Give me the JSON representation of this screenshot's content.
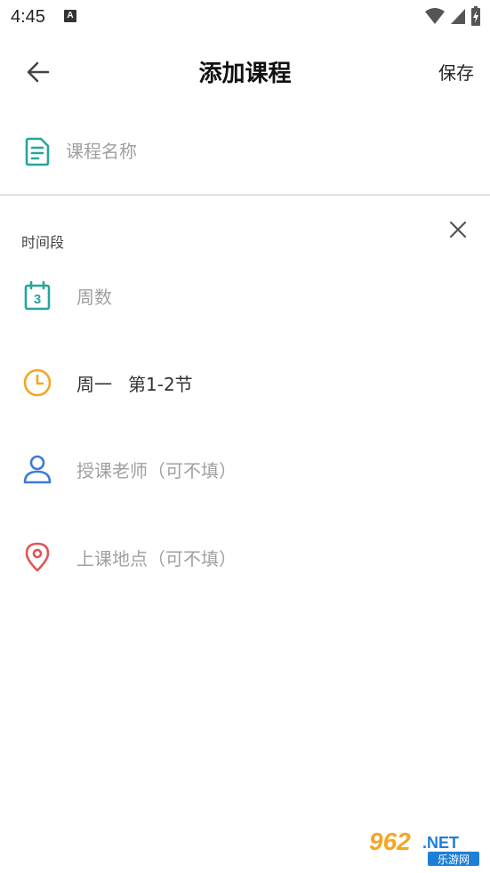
{
  "status_bar": {
    "time": "4:45",
    "notification_glyph": "A"
  },
  "toolbar": {
    "title": "添加课程",
    "save_label": "保存"
  },
  "course_name": {
    "placeholder": "课程名称",
    "value": ""
  },
  "time_section": {
    "label": "时间段",
    "weeks": {
      "placeholder": "周数",
      "calendar_number": "3"
    },
    "schedule": {
      "day": "周一",
      "period": "第1-2节"
    },
    "teacher": {
      "placeholder": "授课老师（可不填）"
    },
    "location": {
      "placeholder": "上课地点（可不填）"
    }
  },
  "colors": {
    "teal": "#26a69a",
    "orange": "#f5a623",
    "blue": "#3d7ad6",
    "red": "#e05555"
  },
  "icons": {
    "back": "arrow-left-icon",
    "document": "document-icon",
    "close": "close-icon",
    "calendar": "calendar-icon",
    "clock": "clock-icon",
    "person": "person-icon",
    "location": "location-pin-icon"
  },
  "watermark": {
    "number": "962",
    "suffix": ".NET",
    "site": "乐游网"
  }
}
